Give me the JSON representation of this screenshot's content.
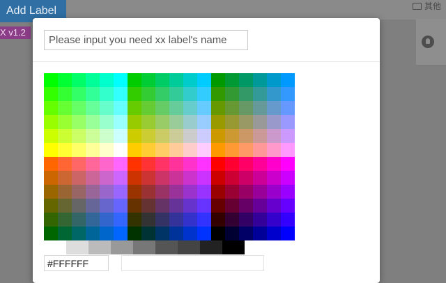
{
  "background": {
    "add_label_button": "Add Label",
    "version_tag": "X  v1.2",
    "bookmark_label": "其他"
  },
  "dialog": {
    "name_input_placeholder": "Please input you need xx label's name",
    "hex_value": "#FFFFFF",
    "preview_color": "#FFFFFF"
  },
  "colors": {
    "button_blue": "#2f6fa3",
    "version_magenta": "#8c3d87",
    "overlay_gray": "#7f7f7f"
  },
  "palette": {
    "grays": [
      "#FFFFFF",
      "#DDDDDD",
      "#BBBBBB",
      "#999999",
      "#777777",
      "#555555",
      "#444444",
      "#222222",
      "#000000"
    ]
  }
}
